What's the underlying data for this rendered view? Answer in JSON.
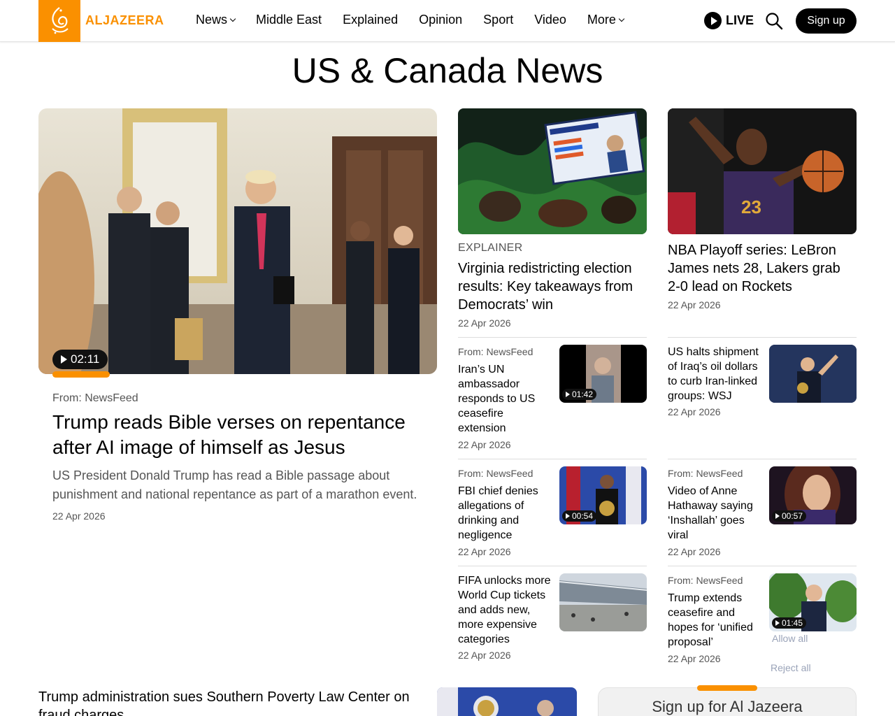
{
  "header": {
    "logo_text": "ALJAZEERA",
    "nav": [
      {
        "label": "News",
        "dropdown": true
      },
      {
        "label": "Middle East",
        "dropdown": false
      },
      {
        "label": "Explained",
        "dropdown": false
      },
      {
        "label": "Opinion",
        "dropdown": false
      },
      {
        "label": "Sport",
        "dropdown": false
      },
      {
        "label": "Video",
        "dropdown": false
      },
      {
        "label": "More",
        "dropdown": true
      }
    ],
    "live_label": "LIVE",
    "signup_label": "Sign up"
  },
  "page_title": "US & Canada News",
  "hero": {
    "duration": "02:11",
    "source": "From: NewsFeed",
    "title": "Trump reads Bible verses on repentance after AI image of himself as Jesus",
    "description": "US President Donald Trump has read a Bible passage about punishment and national repentance as part of a marathon event.",
    "date": "22 Apr 2026"
  },
  "features": [
    {
      "kicker": "EXPLAINER",
      "title": "Virginia redistricting election results: Key takeaways from Democrats’ win",
      "date": "22 Apr 2026"
    },
    {
      "title": "NBA Playoff series: LeBron James nets 28, Lakers grab 2-0 lead on Rockets",
      "date": "22 Apr 2026"
    }
  ],
  "small_stories": [
    {
      "source": "From: NewsFeed",
      "title": "Iran’s UN ambassador responds to US ceasefire extension",
      "duration": "01:42",
      "date": "22 Apr 2026"
    },
    {
      "source": "",
      "title": "US halts shipment of Iraq’s oil dollars to curb Iran-linked groups: WSJ",
      "duration": "",
      "date": "22 Apr 2026"
    },
    {
      "source": "From: NewsFeed",
      "title": "FBI chief denies allegations of drinking and negligence",
      "duration": "00:54",
      "date": "22 Apr 2026"
    },
    {
      "source": "From: NewsFeed",
      "title": "Video of Anne Hathaway saying ‘Inshallah’ goes viral",
      "duration": "00:57",
      "date": "22 Apr 2026"
    },
    {
      "source": "",
      "title": "FIFA unlocks more World Cup tickets and adds new, more expensive categories",
      "duration": "",
      "date": "22 Apr 2026"
    },
    {
      "source": "From: NewsFeed",
      "title": "Trump extends ceasefire and hopes for ‘unified proposal’",
      "duration": "01:45",
      "date": "22 Apr 2026"
    }
  ],
  "bottom": {
    "title": "Trump administration sues Southern Poverty Law Center on fraud charges",
    "signup_box": "Sign up for Al Jazeera"
  },
  "consent": {
    "allow_all": "Allow all",
    "reject_all": "Reject all"
  },
  "colors": {
    "accent": "#fa9000",
    "text": "#000000",
    "muted": "#555555"
  }
}
